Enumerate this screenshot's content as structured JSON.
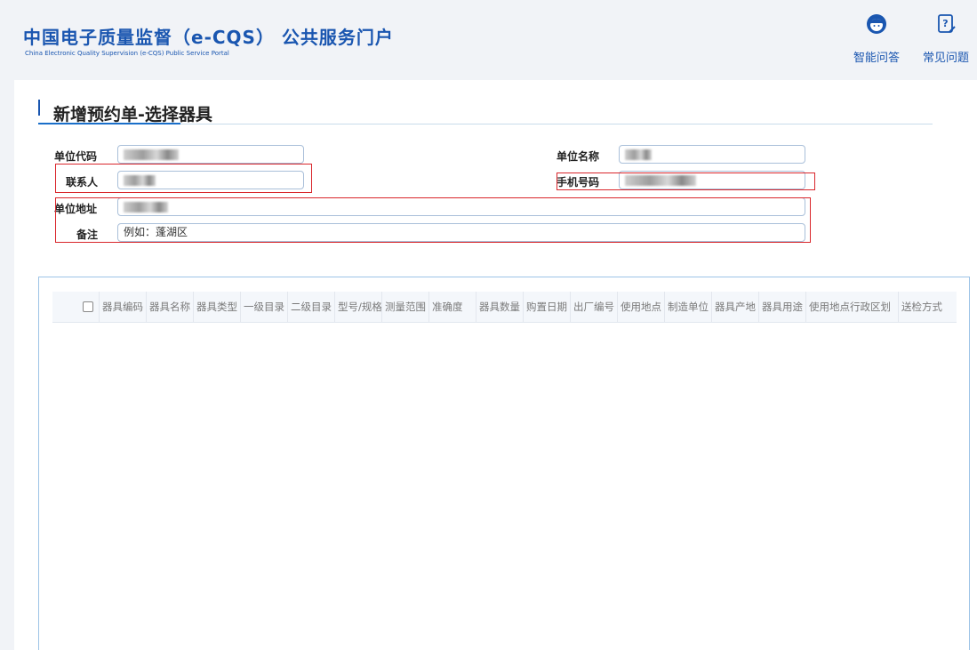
{
  "header": {
    "title": "中国电子质量监督（e-CQS） 公共服务门户",
    "subtitle": "China Electronic Quality Supervision (e-CQS) Public Service Portal",
    "links": [
      {
        "label": "智能问答",
        "icon": "assistant-icon"
      },
      {
        "label": "常见问题",
        "icon": "faq-icon"
      }
    ]
  },
  "page": {
    "title": "新增预约单-选择器具"
  },
  "form": {
    "unit_code_label": "单位代码",
    "unit_name_label": "单位名称",
    "contact_label": "联系人",
    "phone_label": "手机号码",
    "address_label": "单位地址",
    "remark_label": "备注",
    "remark_value": "例如：蓬湖区"
  },
  "grid": {
    "columns": [
      "器具编码",
      "器具名称",
      "器具类型",
      "一级目录",
      "二级目录",
      "型号/规格",
      "测量范围",
      "准确度",
      "器具数量",
      "购置日期",
      "出厂编号",
      "使用地点",
      "制造单位",
      "器具产地",
      "器具用途",
      "使用地点行政区划",
      "送检方式"
    ],
    "rows": []
  }
}
